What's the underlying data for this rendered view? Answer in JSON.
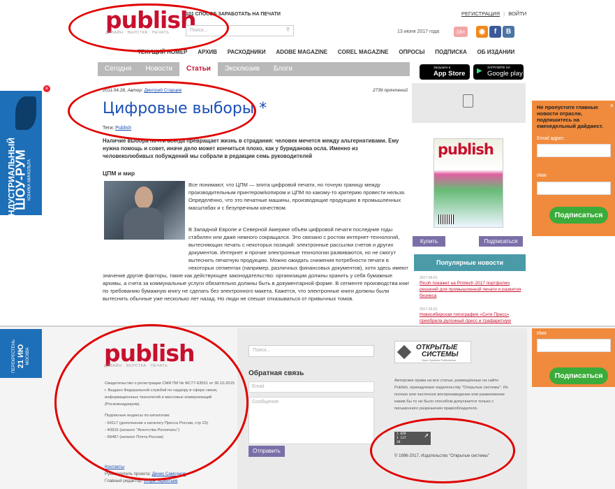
{
  "header": {
    "logo_word": "publish",
    "logo_sub": "ДИЗАЙН · ВЕРСТКА · ПЕЧАТЬ",
    "tagline": "101 СПОСОБ ЗАРАБОТАТЬ НА ПЕЧАТИ",
    "search_placeholder": "Поиск...",
    "register": "РЕГИСТРАЦИЯ",
    "separator": "|",
    "login": "ВОЙТИ",
    "date": "13 июня 2017 года",
    "age_badge": "16+",
    "social": [
      "rss",
      "f",
      "B"
    ]
  },
  "nav": [
    "ТЕКУЩИЙ НОМЕР",
    "АРХИВ",
    "РАСХОДНИКИ",
    "ADOBE MAGAZINE",
    "COREL MAGAZINE",
    "ОПРОСЫ",
    "ПОДПИСКА",
    "ОБ ИЗДАНИИ"
  ],
  "tabs": [
    "Сегодня",
    "Новости",
    "Статьи",
    "Эксклюзив",
    "Блоги"
  ],
  "active_tab": "Статьи",
  "article": {
    "date": "2011.04.28,",
    "author_label": "Автор:",
    "author": "Дмитрий Старцев",
    "reads": "2739 прочтений",
    "title": "Цифровые выборы *",
    "tags_label": "Теги:",
    "tag": "Publish",
    "lead": "Наличие выбора почти всегда превращает жизнь в страдания: человек мечется между альтернативами. Ему нужна помощь и совет, иначе дело может кончиться плохо, как у буриданова осла. Именно из человеколюбивых побуждений мы собрали в редакции семь руководителей",
    "section": "ЦПМ и мир",
    "p1": "Все понимают, что ЦПМ — элита цифровой печати, но точную границу между производительным принтером/копиром и ЦПМ по какому-то критерию провести нельзя. Определённо, что это печатные машины, производящие продукцию в промышленных масштабах и с безупречным качеством.",
    "p2": "В Западной Европе и Северной Америке объём цифровой печати последние годы стабилен или даже немного сокращался. Это связано с ростом интернет-технологий, вытесняющих печать с некоторых позиций: электронные рассылки счетов и других документов. Интернет и прочие электронные технологии развиваются, но не смогут вытеснить печатную продукцию. Можно ожидать снижения потребности печати в некоторых сегментах (например, различных финансовых документов), хотя здесь имеют значение другие факторы, такие как действующее законодательство: организации должны хранить у себя бумажные архивы, а счета за коммунальные услуги обязательно должны быть в документарной форме. В сегменте производства книг по требованию бумажную книгу не сделать без электронного макета. Кажется, что электронные книги должны были вытеснить обычные уже несколько лет назад. Но люди не спешат отказываться от привычных томов."
  },
  "sidebar": {
    "appstore_small": "Загрузите в",
    "appstore": "App Store",
    "googleplay_small": "ЗАГРУЗИТЕ НА",
    "googleplay": "Google play",
    "buy": "Купить",
    "subscribe": "Подписаться",
    "popular_title": "Популярные новости",
    "news": [
      {
        "date": "2017-06-01",
        "text": "Ricoh покажет на Printech 2017 портфолио решений для промышленной печати и развития бизнеса"
      },
      {
        "date": "2017-06-01",
        "text": "Новосибирская типография «Сити Пресс» приобрела рулонный пресс и трафаретную"
      }
    ]
  },
  "left_ad": {
    "line1": "ИНДУСТРИАЛЬНЫЙ",
    "line2": "ШОУ-РУМ",
    "line3": "КОНИКА МИНОЛЬТА"
  },
  "left_ad2": {
    "line1": "ПЕРЕКРЕСТЕНЬ",
    "line2": "21 ИЮ",
    "line3": "МОСКВА"
  },
  "right_form": {
    "heading": "Не пропустите главные новости отрасли, подпишитесь на еженедельный дайджест.",
    "email_label": "Email адрес",
    "name_label": "Имя",
    "button": "Подписаться",
    "close": "×"
  },
  "right_form2": {
    "name_label": "Имя",
    "button": "Подписаться"
  },
  "footer": {
    "logo_word": "publish",
    "logo_sub": "ДИЗАЙН · ВЕРСТКА · ПЕЧАТЬ",
    "registration": "Свидетельство о регистрации СМИ ПИ № ФС77-63551 от 30.10.2015 г. Выдано Федеральной службой по надзору в сфере связи, информационных технологий и массовых коммуникаций (Роскомнадзором).",
    "catalogs_title": "Подписные индексы по каталогам:",
    "catalogs": [
      "- 64117 (дополнение к каталогу Пресса России, стр 23)",
      "- 40915 (каталог \"Агентства Роспечать\")",
      "- 99487 (каталог Почта России)"
    ],
    "contacts": "Контакты",
    "manager_label": "Руководитель проекта:",
    "manager": "Денис Самсонов",
    "editor_label": "Главный редактор:",
    "editor": "Игорь Терентьев",
    "search_placeholder": "Поиск...",
    "feedback_title": "Обратная связь",
    "email_placeholder": "Email",
    "message_placeholder": "Сообщение",
    "send": "Отправить",
    "os_line1": "ОТКРЫТЫЕ",
    "os_line2": "СИСТЕМЫ",
    "os_sub": "Open Systems Publications",
    "rights": "Авторские права на все статьи, размещённые на сайте Publish, принадлежат издательству \"Открытые системы\". Их полное или частичное воспроизведение или размножение каким бы то ни было способом допускается только с письменного разрешения правообладателя.",
    "counter1": "1 849",
    "counter2": "1 137",
    "counter3": "38",
    "copyright": "© 1996-2017, Издательство \"Открытые системы\""
  },
  "colors": {
    "brand_red": "#c8102e",
    "link_blue": "#1a4fb5",
    "teal": "#4a9aa8",
    "purple": "#7b6fa8",
    "orange": "#f08a3c",
    "green": "#3bab3b",
    "annotation_red": "#e00000"
  }
}
